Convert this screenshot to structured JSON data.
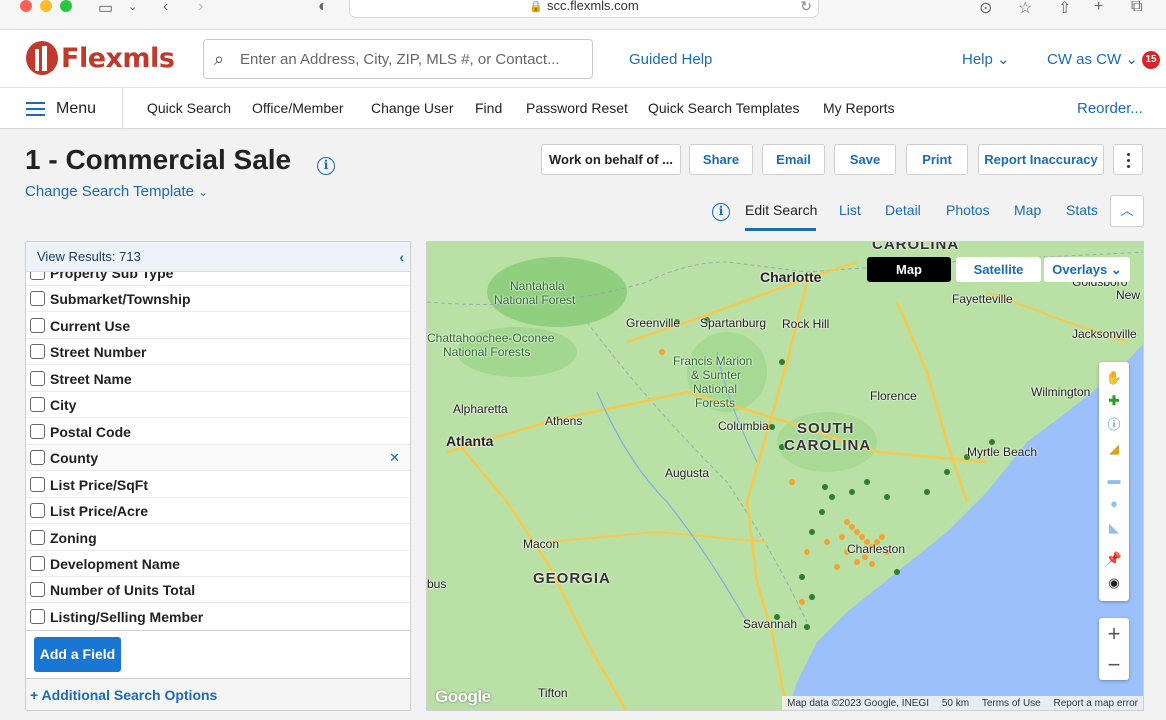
{
  "browser": {
    "url": "scc.flexmls.com"
  },
  "header": {
    "brand": "Flexmls",
    "search_placeholder": "Enter an Address, City, ZIP, MLS #, or Contact...",
    "guided_help": "Guided Help",
    "help": "Help",
    "user": "CW as CW",
    "notifications": "15"
  },
  "nav": {
    "menu": "Menu",
    "items": [
      "Quick Search",
      "Office/Member",
      "Change User",
      "Find",
      "Password Reset",
      "Quick Search Templates",
      "My Reports"
    ],
    "reorder": "Reorder..."
  },
  "page": {
    "title": "1 - Commercial Sale",
    "change_template": "Change Search Template"
  },
  "toolbar": {
    "work_on_behalf": "Work on behalf of ...",
    "share": "Share",
    "email": "Email",
    "save": "Save",
    "print": "Print",
    "report_inaccuracy": "Report Inaccuracy"
  },
  "view_tabs": [
    "Edit Search",
    "List",
    "Detail",
    "Photos",
    "Map",
    "Stats"
  ],
  "results": {
    "label": "View Results: 713"
  },
  "fields": [
    "Property Sub Type",
    "Submarket/Township",
    "Current Use",
    "Street Number",
    "Street Name",
    "City",
    "Postal Code",
    "County",
    "List Price/SqFt",
    "List Price/Acre",
    "Zoning",
    "Development Name",
    "Number of Units Total",
    "Listing/Selling Member"
  ],
  "add_field": "Add a Field",
  "additional_options": "Additional Search Options",
  "map": {
    "buttons": {
      "map": "Map",
      "satellite": "Satellite",
      "overlays": "Overlays"
    },
    "labels": {
      "carolina": "CAROLINA",
      "charlotte": "Charlotte",
      "nantahala": "Nantahala",
      "national_forest": "National Forest",
      "fayetteville": "Fayetteville",
      "goldsboro": "Goldsboro",
      "new": "New",
      "greenville": "Greenville",
      "spartanburg": "Spartanburg",
      "rock_hill": "Rock Hill",
      "jacksonville": "Jacksonville",
      "chattahoochee": "Chattahoochee-Oconee",
      "national_forests": "National Forests",
      "francis_marion": "Francis Marion",
      "sumter": "& Sumter",
      "national": "National",
      "forests": "Forests",
      "wilmington": "Wilmington",
      "alpharetta": "Alpharetta",
      "athens": "Athens",
      "florence": "Florence",
      "south": "SOUTH",
      "carolina2": "CAROLINA",
      "columbia": "Columbia",
      "atlanta": "Atlanta",
      "myrtle_beach": "Myrtle Beach",
      "augusta": "Augusta",
      "charleston": "Charleston",
      "macon": "Macon",
      "georgia": "GEORGIA",
      "bus": "bus",
      "savannah": "Savannah",
      "tifton": "Tifton"
    },
    "attribution": {
      "data": "Map data ©2023 Google, INEGI",
      "scale": "50 km",
      "terms": "Terms of Use",
      "report": "Report a map error"
    },
    "google": "Google"
  },
  "colors": {
    "brand_red": "#c1392b",
    "link_blue": "#1a6bb8",
    "primary_button": "#1976d2",
    "marker_orange": "#f4a233",
    "marker_green": "#2e7d32"
  }
}
